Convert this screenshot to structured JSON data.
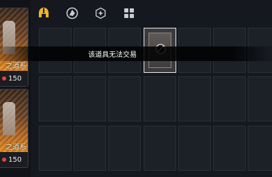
{
  "shop_cards": [
    {
      "name": "之道系",
      "price": "150"
    },
    {
      "name": "之道系",
      "price": "150"
    }
  ],
  "tabs": [
    {
      "icon": "helmet-icon",
      "active": true
    },
    {
      "icon": "cards-icon",
      "active": false
    },
    {
      "icon": "hexagon-badge-icon",
      "active": false
    },
    {
      "icon": "grid-blocks-icon",
      "active": false
    }
  ],
  "tooltip": {
    "message": "该道具无法交易"
  },
  "colors": {
    "accent": "#f0b429",
    "coin": "#e0463a",
    "selected_border": "#e9e9e9"
  }
}
